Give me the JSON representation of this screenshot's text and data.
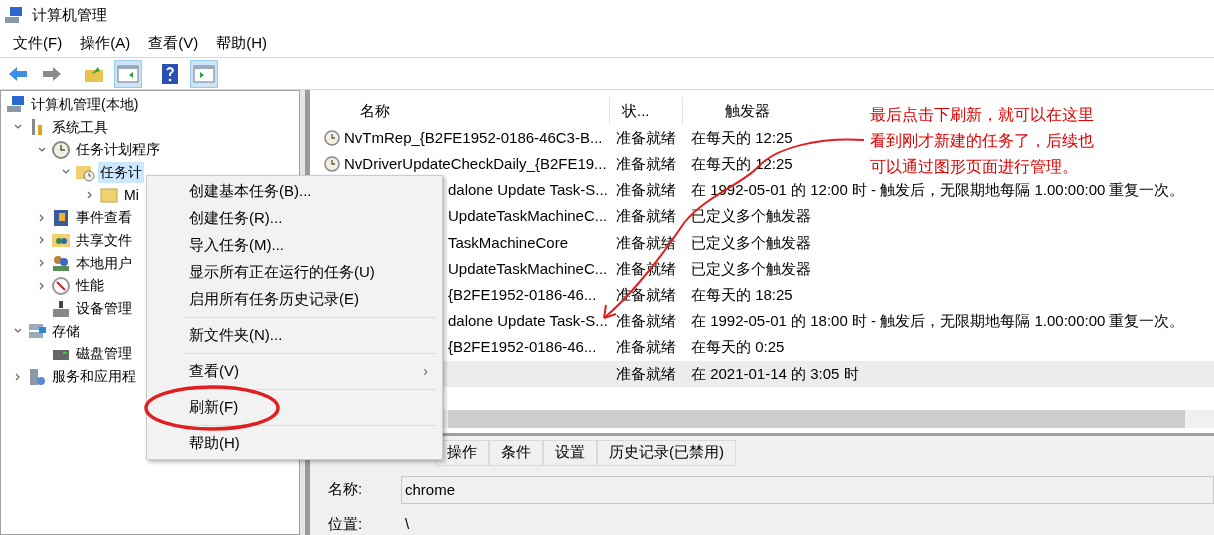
{
  "window": {
    "title": "计算机管理"
  },
  "menu_bar": [
    "文件(F)",
    "操作(A)",
    "查看(V)",
    "帮助(H)"
  ],
  "toolbar": [
    {
      "kind": "back",
      "pressed": false
    },
    {
      "kind": "forward",
      "pressed": false
    },
    {
      "kind": "up",
      "pressed": false
    },
    {
      "kind": "tree",
      "pressed": true
    },
    {
      "kind": "help",
      "pressed": false
    },
    {
      "kind": "actions",
      "pressed": true
    }
  ],
  "tree": [
    {
      "label": "计算机管理(本地)",
      "kind": "computer",
      "selected": false,
      "children": [
        {
          "label": "系统工具",
          "kind": "tools",
          "selected": false,
          "expanded": true,
          "children": [
            {
              "label": "任务计划程序",
              "kind": "clock",
              "selected": false,
              "expanded": true,
              "children": [
                {
                  "label": "任务计",
                  "kind": "folder-clock",
                  "selected": true,
                  "expanded": true,
                  "children": [
                    {
                      "label": "Mi",
                      "kind": "folder",
                      "selected": false,
                      "expanded": false
                    }
                  ]
                }
              ]
            },
            {
              "label": "事件查看",
              "kind": "event",
              "selected": false,
              "expanded": false
            },
            {
              "label": "共享文件",
              "kind": "share",
              "selected": false,
              "expanded": false
            },
            {
              "label": "本地用户",
              "kind": "users",
              "selected": false,
              "expanded": false
            },
            {
              "label": "性能",
              "kind": "perf",
              "selected": false,
              "expanded": false
            },
            {
              "label": "设备管理",
              "kind": "device",
              "selected": false
            }
          ]
        },
        {
          "label": "存储",
          "kind": "storage",
          "selected": false,
          "expanded": true,
          "children": [
            {
              "label": "磁盘管理",
              "kind": "disk",
              "selected": false
            }
          ]
        },
        {
          "label": "服务和应用程",
          "kind": "services",
          "selected": false,
          "expanded": false
        }
      ]
    }
  ],
  "table": {
    "columns": [
      "名称",
      "状...",
      "触发器"
    ],
    "rows": [
      {
        "kind": "full",
        "name": "NvTmRep_{B2FE1952-0186-46C3-B...",
        "status": "准备就绪",
        "trigger": "在每天的 12:25",
        "selected": false
      },
      {
        "kind": "full",
        "name": "NvDriverUpdateCheckDaily_{B2FE19...",
        "status": "准备就绪",
        "trigger": "在每天的 12:25",
        "selected": false
      },
      {
        "kind": "partial",
        "name": "dalone Update Task-S...",
        "status": "准备就绪",
        "trigger": "在 1992-05-01 的 12:00 时 - 触发后，无限期地每隔 1.00:00:00 重复一次。",
        "selected": false
      },
      {
        "kind": "partial",
        "name": "UpdateTaskMachineC...",
        "status": "准备就绪",
        "trigger": "已定义多个触发器",
        "selected": false
      },
      {
        "kind": "partial",
        "name": "TaskMachineCore",
        "status": "准备就绪",
        "trigger": "已定义多个触发器",
        "selected": false
      },
      {
        "kind": "partial",
        "name": "UpdateTaskMachineC...",
        "status": "准备就绪",
        "trigger": "已定义多个触发器",
        "selected": false
      },
      {
        "kind": "partial",
        "name": "{B2FE1952-0186-46...",
        "status": "准备就绪",
        "trigger": "在每天的 18:25",
        "selected": false
      },
      {
        "kind": "partial",
        "name": "dalone Update Task-S...",
        "status": "准备就绪",
        "trigger": "在 1992-05-01 的 18:00 时 - 触发后，无限期地每隔 1.00:00:00 重复一次。",
        "selected": false
      },
      {
        "kind": "partial",
        "name": "{B2FE1952-0186-46...",
        "status": "准备就绪",
        "trigger": "在每天的 0:25",
        "selected": false
      },
      {
        "kind": "partial",
        "status": "准备就绪",
        "trigger": "在 2021-01-14 的 3:05 时",
        "selected": true
      }
    ]
  },
  "detail": {
    "tabs": [
      "操作",
      "条件",
      "设置",
      "历史记录(已禁用)"
    ],
    "fields": [
      {
        "label": "名称:",
        "value": "chrome",
        "kind": "input"
      },
      {
        "label": "位置:",
        "value": "\\",
        "kind": "text"
      }
    ]
  },
  "context_menu": [
    {
      "kind": "item",
      "label": "创建基本任务(B)...",
      "circled": false
    },
    {
      "kind": "item",
      "label": "创建任务(R)...",
      "circled": false
    },
    {
      "kind": "item",
      "label": "导入任务(M)...",
      "circled": false
    },
    {
      "kind": "item",
      "label": "显示所有正在运行的任务(U)",
      "circled": false
    },
    {
      "kind": "item",
      "label": "启用所有任务历史记录(E)",
      "circled": false
    },
    {
      "kind": "separator"
    },
    {
      "kind": "item",
      "label": "新文件夹(N)...",
      "circled": false
    },
    {
      "kind": "separator"
    },
    {
      "kind": "submenu",
      "label": "查看(V)",
      "arrow": "›",
      "circled": false
    },
    {
      "kind": "separator"
    },
    {
      "kind": "item",
      "label": "刷新(F)",
      "circled": true
    },
    {
      "kind": "separator"
    },
    {
      "kind": "item",
      "label": "帮助(H)",
      "circled": false
    }
  ],
  "annotation": {
    "lines": [
      "最后点击下刷新，就可以在这里",
      "看到刚才新建的任务了，后续也",
      "可以通过图形页面进行管理。"
    ]
  }
}
